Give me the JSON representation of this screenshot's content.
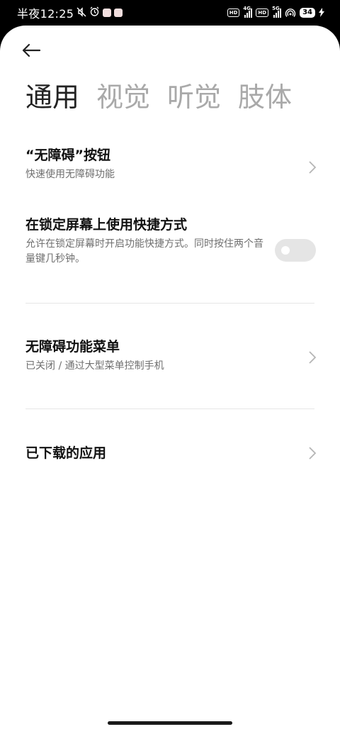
{
  "status_bar": {
    "time": "半夜12:25",
    "battery": "34",
    "net1": "4G",
    "net2": "5G",
    "hd": "HD"
  },
  "header": {
    "tabs": [
      {
        "label": "通用",
        "active": true
      },
      {
        "label": "视觉",
        "active": false
      },
      {
        "label": "听觉",
        "active": false
      },
      {
        "label": "肢体",
        "active": false
      }
    ]
  },
  "items": [
    {
      "title": "“无障碍”按钮",
      "subtitle": "快速使用无障碍功能"
    },
    {
      "title": "在锁定屏幕上使用快捷方式",
      "subtitle": "允许在锁定屏幕时开启功能快捷方式。同时按住两个音量键几秒钟。",
      "toggle_on": false
    },
    {
      "title": "无障碍功能菜单",
      "subtitle": "已关闭 / 通过大型菜单控制手机"
    },
    {
      "title": "已下载的应用"
    }
  ]
}
